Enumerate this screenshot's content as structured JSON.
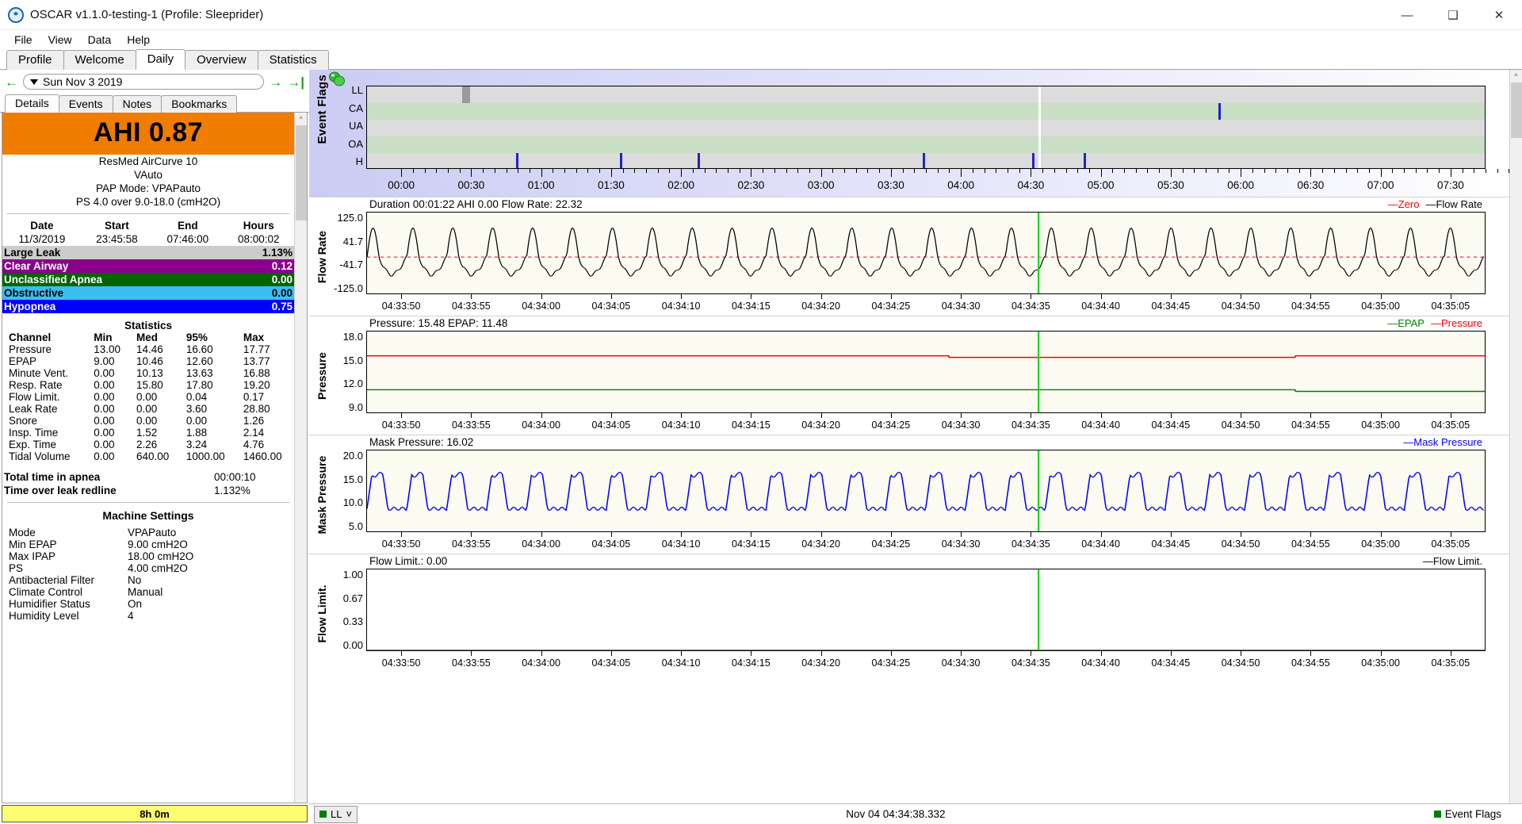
{
  "window": {
    "title": "OSCAR v1.1.0-testing-1 (Profile: Sleeprider)",
    "app_icon": "oscar-icon",
    "minimize": "—",
    "maximize": "❑",
    "close": "✕"
  },
  "menubar": {
    "items": [
      "File",
      "View",
      "Data",
      "Help"
    ]
  },
  "main_tabs": {
    "items": [
      "Profile",
      "Welcome",
      "Daily",
      "Overview",
      "Statistics"
    ],
    "active": "Daily"
  },
  "date_nav": {
    "prev_icon": "arrow-left-icon",
    "next_icon": "arrow-right-icon",
    "last_icon": "arrow-end-icon",
    "date": "Sun Nov 3 2019"
  },
  "sub_tabs": {
    "items": [
      "Details",
      "Events",
      "Notes",
      "Bookmarks"
    ],
    "active": "Details"
  },
  "details": {
    "ahi_label": "AHI 0.87",
    "ahi_color": "#f07c00",
    "machine": [
      "ResMed AirCurve 10",
      "VAuto",
      "PAP Mode: VPAPauto",
      "PS 4.0 over 9.0-18.0 (cmH2O)"
    ],
    "session_headers": [
      "Date",
      "Start",
      "End",
      "Hours"
    ],
    "session_values": [
      "11/3/2019",
      "23:45:58",
      "07:46:00",
      "08:00:02"
    ],
    "events": [
      {
        "label": "Large Leak",
        "value": "1.13%",
        "bg": "#cccccc",
        "fg": "#000000"
      },
      {
        "label": "Clear Airway",
        "value": "0.12",
        "bg": "#8b008b",
        "fg": "#ffffff"
      },
      {
        "label": "Unclassified Apnea",
        "value": "0.00",
        "bg": "#006400",
        "fg": "#ffffff"
      },
      {
        "label": "Obstructive",
        "value": "0.00",
        "bg": "#3cbdf0",
        "fg": "#000000"
      },
      {
        "label": "Hypopnea",
        "value": "0.75",
        "bg": "#0000ff",
        "fg": "#ffffff"
      }
    ],
    "statistics_title": "Statistics",
    "stat_headers": [
      "Channel",
      "Min",
      "Med",
      "95%",
      "Max"
    ],
    "stat_rows": [
      [
        "Pressure",
        "13.00",
        "14.46",
        "16.60",
        "17.77"
      ],
      [
        "EPAP",
        "9.00",
        "10.46",
        "12.60",
        "13.77"
      ],
      [
        "Minute Vent.",
        "0.00",
        "10.13",
        "13.63",
        "16.88"
      ],
      [
        "Resp. Rate",
        "0.00",
        "15.80",
        "17.80",
        "19.20"
      ],
      [
        "Flow Limit.",
        "0.00",
        "0.00",
        "0.04",
        "0.17"
      ],
      [
        "Leak Rate",
        "0.00",
        "0.00",
        "3.60",
        "28.80"
      ],
      [
        "Snore",
        "0.00",
        "0.00",
        "0.00",
        "1.26"
      ],
      [
        "Insp. Time",
        "0.00",
        "1.52",
        "1.88",
        "2.14"
      ],
      [
        "Exp. Time",
        "0.00",
        "2.26",
        "3.24",
        "4.76"
      ],
      [
        "Tidal Volume",
        "0.00",
        "640.00",
        "1000.00",
        "1460.00"
      ]
    ],
    "totals": [
      {
        "label": "Total time in apnea",
        "value": "00:00:10"
      },
      {
        "label": "Time over leak redline",
        "value": "1.132%"
      }
    ],
    "machine_settings_title": "Machine Settings",
    "machine_settings": [
      {
        "key": "Mode",
        "value": "VPAPauto"
      },
      {
        "key": "Min EPAP",
        "value": "9.00 cmH2O"
      },
      {
        "key": "Max IPAP",
        "value": "18.00 cmH2O"
      },
      {
        "key": "PS",
        "value": "4.00 cmH2O"
      },
      {
        "key": "Antibacterial Filter",
        "value": "No"
      },
      {
        "key": "Climate Control",
        "value": "Manual"
      },
      {
        "key": "Humidifier Status",
        "value": "On"
      },
      {
        "key": "Humidity Level",
        "value": "4"
      }
    ],
    "bottom_bar": "8h 0m",
    "bottom_bar_color": "#fdfd72"
  },
  "chart_data": [
    {
      "type": "heatmap",
      "name": "event-flags",
      "title": "Event Flags",
      "categories": [
        "LL",
        "CA",
        "UA",
        "OA",
        "H"
      ],
      "xlabel": "",
      "x_ticks": [
        "00:00",
        "00:30",
        "01:00",
        "01:30",
        "02:00",
        "02:30",
        "03:00",
        "03:30",
        "04:00",
        "04:30",
        "05:00",
        "05:30",
        "06:00",
        "06:30",
        "07:00",
        "07:30"
      ],
      "xlim": [
        "23:45",
        "07:46"
      ],
      "events": [
        {
          "row": "LL",
          "x": 0.085,
          "w": 0.008,
          "color": "#9a9a9a"
        },
        {
          "row": "CA",
          "x": 0.762,
          "w": 0.002,
          "color": "#2222cc"
        },
        {
          "row": "H",
          "x": 0.133,
          "w": 0.002,
          "color": "#2222cc"
        },
        {
          "row": "H",
          "x": 0.226,
          "w": 0.002,
          "color": "#2222cc"
        },
        {
          "row": "H",
          "x": 0.296,
          "w": 0.002,
          "color": "#2222cc"
        },
        {
          "row": "H",
          "x": 0.497,
          "w": 0.002,
          "color": "#2222cc"
        },
        {
          "row": "H",
          "x": 0.595,
          "w": 0.002,
          "color": "#2222cc"
        },
        {
          "row": "H",
          "x": 0.641,
          "w": 0.002,
          "color": "#2222cc"
        }
      ],
      "cursor_x": 0.601,
      "cursor_color": "#ffffff"
    },
    {
      "type": "line",
      "name": "flow-rate",
      "title": "Flow Rate",
      "header": "Duration 00:01:22 AHI 0.00 Flow Rate: 22.32",
      "legend": [
        {
          "label": "Zero",
          "color": "#ff0000"
        },
        {
          "label": "Flow Rate",
          "color": "#000000"
        }
      ],
      "y_ticks": [
        "125.0",
        "41.7",
        "-41.7",
        "-125.0"
      ],
      "ylim": [
        -125.0,
        125.0
      ],
      "x_ticks": [
        "04:33:50",
        "04:33:55",
        "04:34:00",
        "04:34:05",
        "04:34:10",
        "04:34:15",
        "04:34:20",
        "04:34:25",
        "04:34:30",
        "04:34:35",
        "04:34:40",
        "04:34:45",
        "04:34:50",
        "04:34:55",
        "04:35:00",
        "04:35:05"
      ],
      "series_color": "#000000",
      "zero_line_color": "#ff0000",
      "cursor_color": "#00dd00"
    },
    {
      "type": "line",
      "name": "pressure",
      "title": "Pressure",
      "header": "Pressure: 15.48 EPAP: 11.48",
      "legend": [
        {
          "label": "EPAP",
          "color": "#008000"
        },
        {
          "label": "Pressure",
          "color": "#ff0000"
        }
      ],
      "y_ticks": [
        "18.0",
        "15.0",
        "12.0",
        "9.0"
      ],
      "ylim": [
        9.0,
        18.0
      ],
      "x_ticks": [
        "04:33:50",
        "04:33:55",
        "04:34:00",
        "04:34:05",
        "04:34:10",
        "04:34:15",
        "04:34:20",
        "04:34:25",
        "04:34:30",
        "04:34:35",
        "04:34:40",
        "04:34:45",
        "04:34:50",
        "04:34:55",
        "04:35:00",
        "04:35:05"
      ],
      "series": [
        {
          "name": "Pressure",
          "color": "#ff0000",
          "value": 15.48
        },
        {
          "name": "EPAP",
          "color": "#008000",
          "value": 11.48
        }
      ],
      "cursor_color": "#00dd00"
    },
    {
      "type": "line",
      "name": "mask-pressure",
      "title": "Mask Pressure",
      "header": "Mask Pressure: 16.02",
      "legend": [
        {
          "label": "Mask Pressure",
          "color": "#0000ff"
        }
      ],
      "y_ticks": [
        "20.0",
        "15.0",
        "10.0",
        "5.0"
      ],
      "ylim": [
        5.0,
        20.0
      ],
      "x_ticks": [
        "04:33:50",
        "04:33:55",
        "04:34:00",
        "04:34:05",
        "04:34:10",
        "04:34:15",
        "04:34:20",
        "04:34:25",
        "04:34:30",
        "04:34:35",
        "04:34:40",
        "04:34:45",
        "04:34:50",
        "04:34:55",
        "04:35:00",
        "04:35:05"
      ],
      "series_color": "#0000ff",
      "cursor_color": "#00dd00"
    },
    {
      "type": "line",
      "name": "flow-limit",
      "title": "Flow Limit.",
      "header": "Flow Limit.: 0.00",
      "legend": [
        {
          "label": "Flow Limit.",
          "color": "#000000"
        }
      ],
      "y_ticks": [
        "1.00",
        "0.67",
        "0.33",
        "0.00"
      ],
      "ylim": [
        0.0,
        1.0
      ],
      "x_ticks": [
        "04:33:50",
        "04:33:55",
        "04:34:00",
        "04:34:05",
        "04:34:10",
        "04:34:15",
        "04:34:20",
        "04:34:25",
        "04:34:30",
        "04:34:35",
        "04:34:40",
        "04:34:45",
        "04:34:50",
        "04:34:55",
        "04:35:00",
        "04:35:05"
      ],
      "series_color": "#000000",
      "cursor_color": "#00dd00"
    }
  ],
  "status_bar": {
    "left_selector": "LL",
    "left_selector_color": "#008000",
    "center": "Nov 04 04:34:38.332",
    "right": "Event Flags",
    "right_color": "#008000"
  }
}
